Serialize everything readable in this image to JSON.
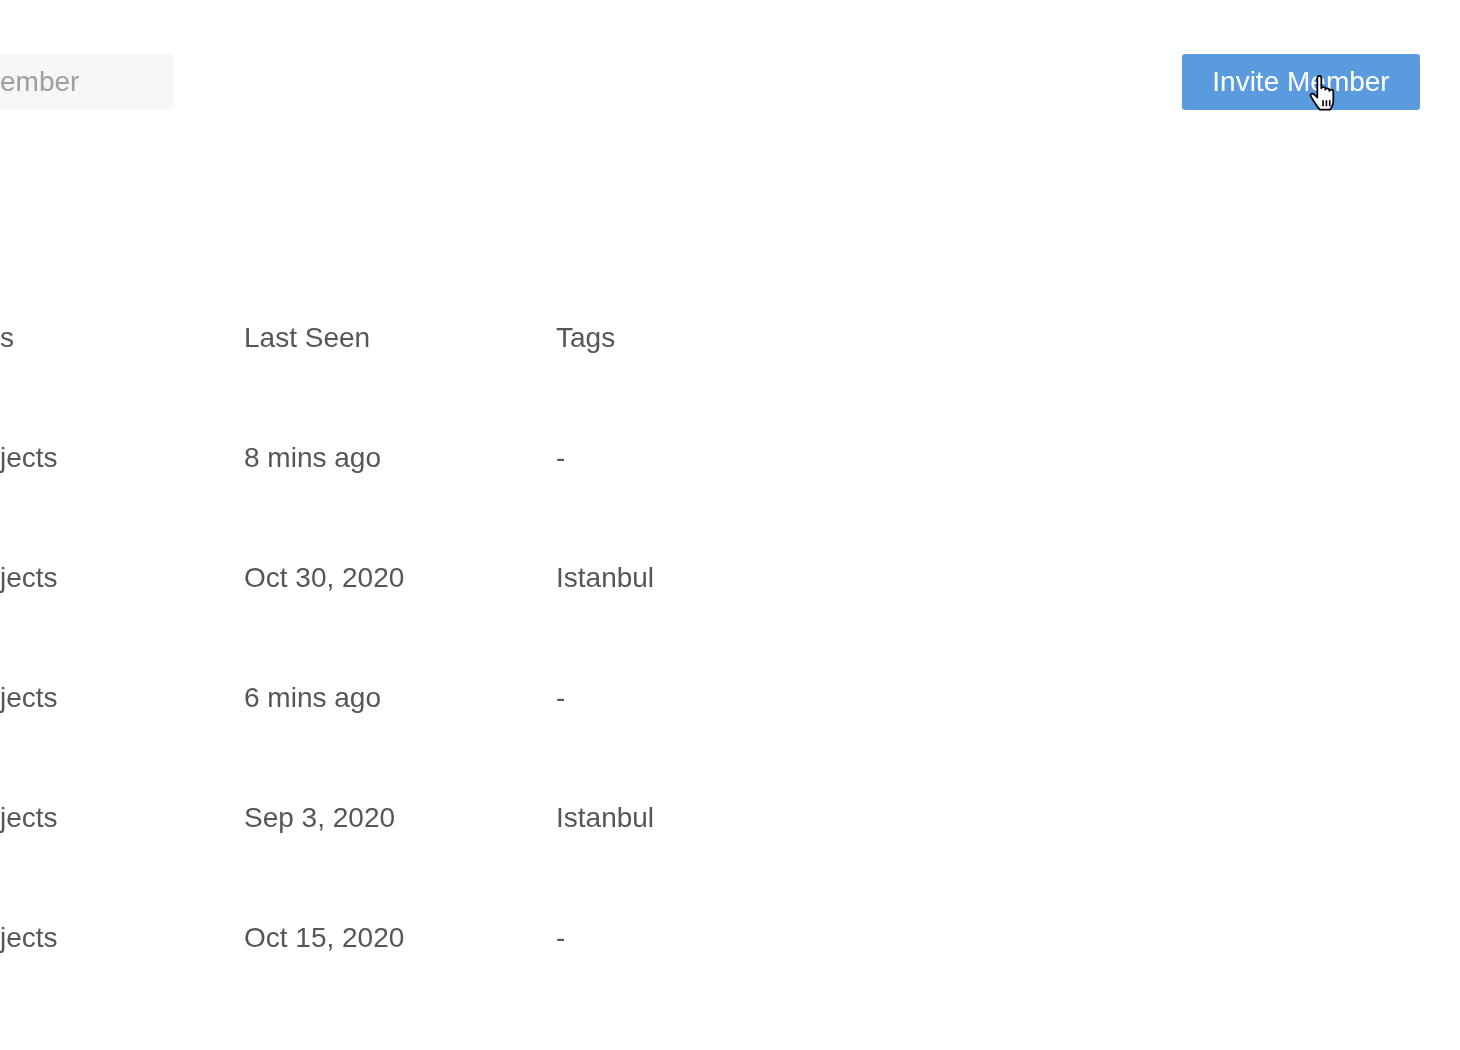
{
  "search": {
    "placeholder": "ember"
  },
  "invite_button": {
    "label": "Invite Member"
  },
  "table": {
    "columns": [
      "s",
      "Last Seen",
      "Tags"
    ],
    "rows": [
      [
        "jects",
        "8 mins ago",
        "-"
      ],
      [
        "jects",
        "Oct 30, 2020",
        "Istanbul"
      ],
      [
        "jects",
        "6 mins ago",
        "-"
      ],
      [
        "jects",
        "Sep 3, 2020",
        "Istanbul"
      ],
      [
        "jects",
        "Oct 15, 2020",
        "-"
      ]
    ]
  }
}
